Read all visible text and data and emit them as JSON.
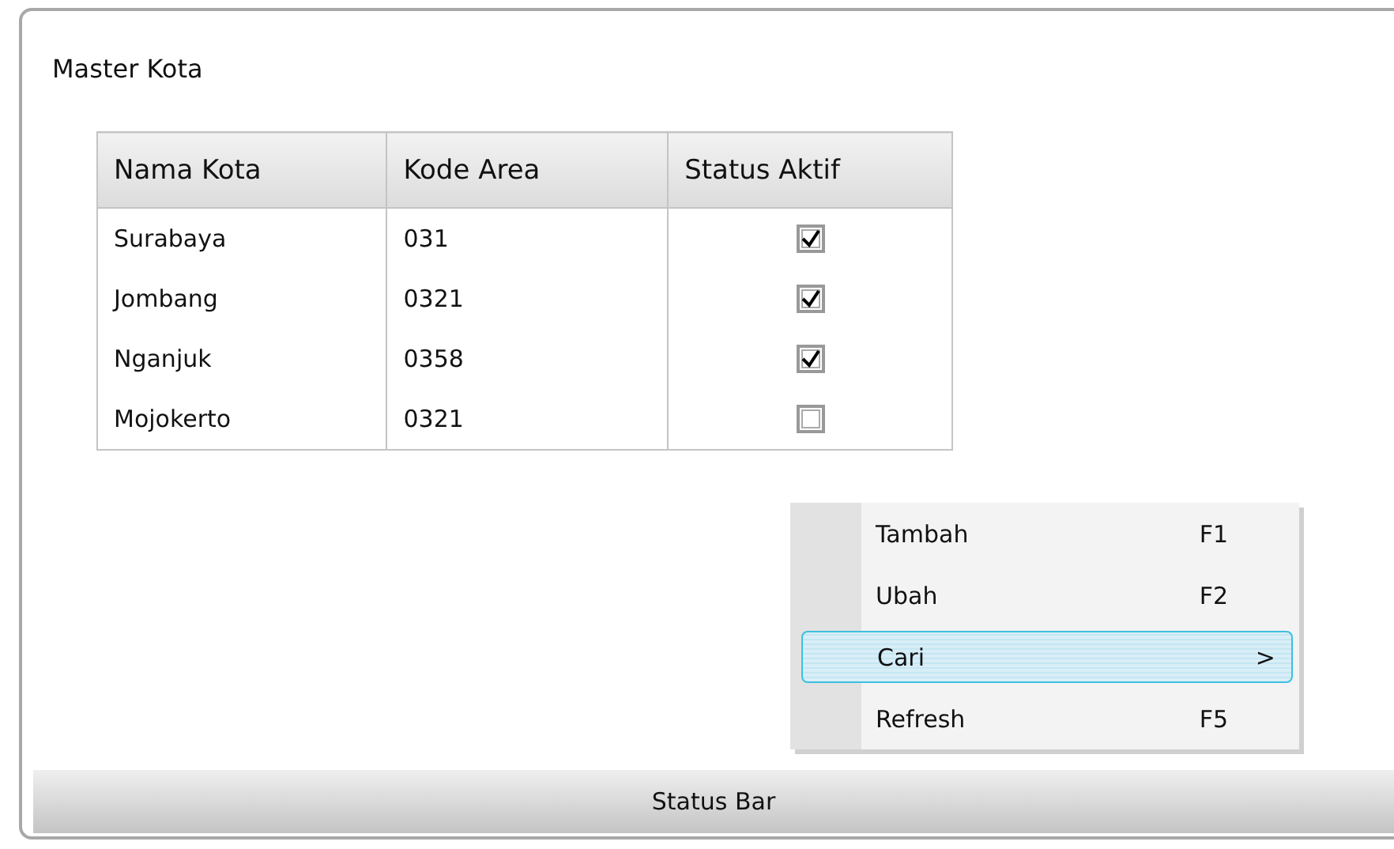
{
  "window": {
    "title": "Master Kota"
  },
  "table": {
    "columns": [
      "Nama Kota",
      "Kode Area",
      "Status Aktif"
    ],
    "rows": [
      {
        "name": "Surabaya",
        "code": "031",
        "active": true
      },
      {
        "name": "Jombang",
        "code": "0321",
        "active": true
      },
      {
        "name": "Nganjuk",
        "code": "0358",
        "active": true
      },
      {
        "name": "Mojokerto",
        "code": "0321",
        "active": false
      }
    ]
  },
  "context_menu": {
    "items": [
      {
        "label": "Tambah",
        "shortcut": "F1",
        "selected": false
      },
      {
        "label": "Ubah",
        "shortcut": "F2",
        "selected": false
      },
      {
        "label": "Cari",
        "shortcut": ">",
        "selected": true
      },
      {
        "label": "Refresh",
        "shortcut": "F5",
        "selected": false
      }
    ]
  },
  "status_bar": "Status Bar"
}
